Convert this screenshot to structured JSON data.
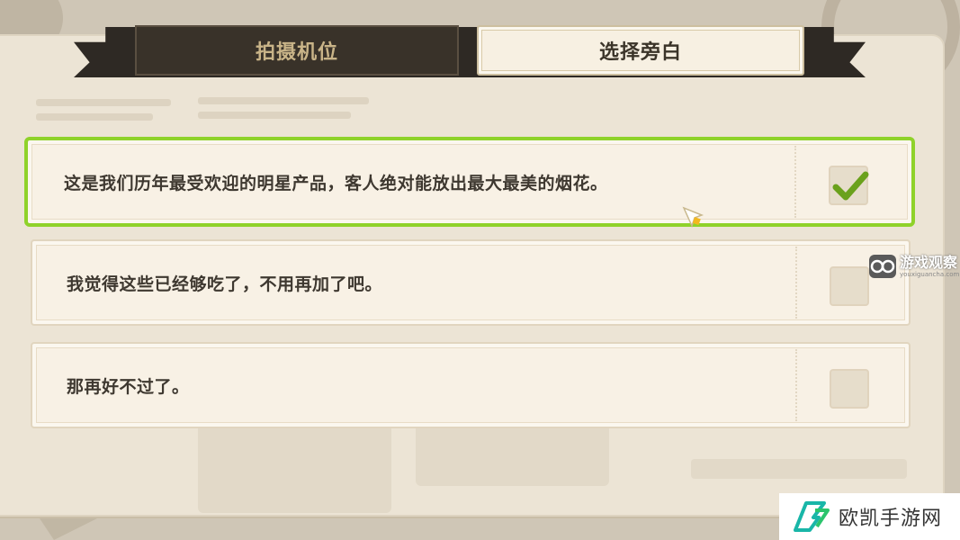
{
  "tabs": [
    {
      "label": "拍摄机位",
      "active": false
    },
    {
      "label": "选择旁白",
      "active": true
    }
  ],
  "options": [
    {
      "text": "这是我们历年最受欢迎的明星产品，客人绝对能放出最大最美的烟花。",
      "checked": true
    },
    {
      "text": "我觉得这些已经够吃了，不用再加了吧。",
      "checked": false
    },
    {
      "text": "那再好不过了。",
      "checked": false
    }
  ],
  "watermarks": {
    "site1_title": "游戏观察",
    "site1_url": "youxiguancha.com",
    "site2_title": "欧凯手游网"
  },
  "colors": {
    "selected_border": "#8fd22a",
    "checkmark": "#6aa11c",
    "tab_active_bg": "#f7f0e2",
    "tab_inactive_bg": "#393229",
    "tab_inactive_text": "#c9b488"
  },
  "icons": {
    "check": "checkmark-icon",
    "cursor": "pointer-cursor-icon",
    "logo1": "binoculars-logo-icon",
    "logo2": "ok-logo-icon"
  }
}
